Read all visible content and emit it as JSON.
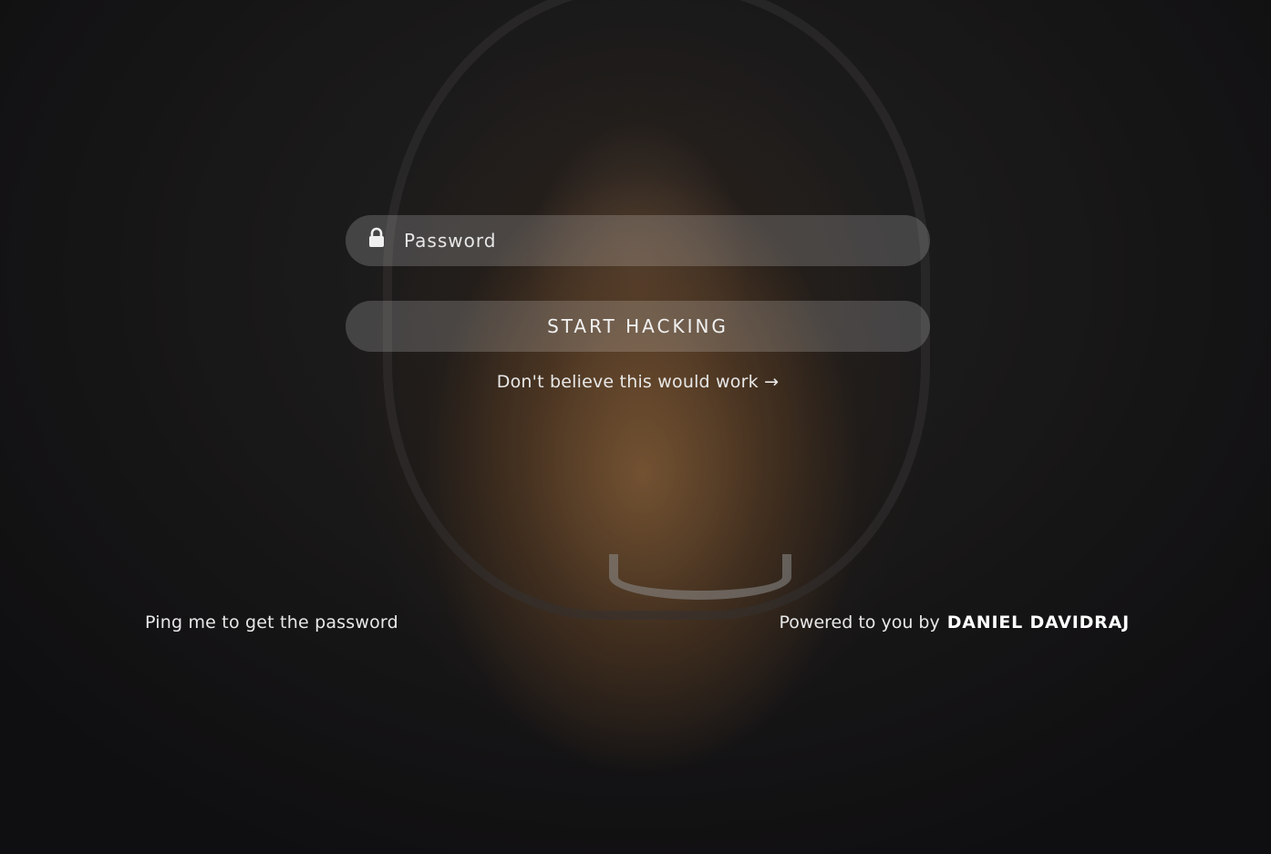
{
  "background": {
    "image_subject": "woman-in-hood-photo"
  },
  "login": {
    "password_placeholder": "Password",
    "password_value": "",
    "lock_icon": "lock-icon",
    "submit_label": "START HACKING",
    "doubt_link_label": "Don't believe this would work",
    "arrow_icon": "→"
  },
  "footer": {
    "left_text": "Ping me to get the password",
    "powered_text": "Powered to you by",
    "author_name": "DANIEL DAVIDRAJ"
  },
  "colors": {
    "text": "#e8e8e8",
    "field_bg": "rgba(255,255,255,0.18)"
  }
}
